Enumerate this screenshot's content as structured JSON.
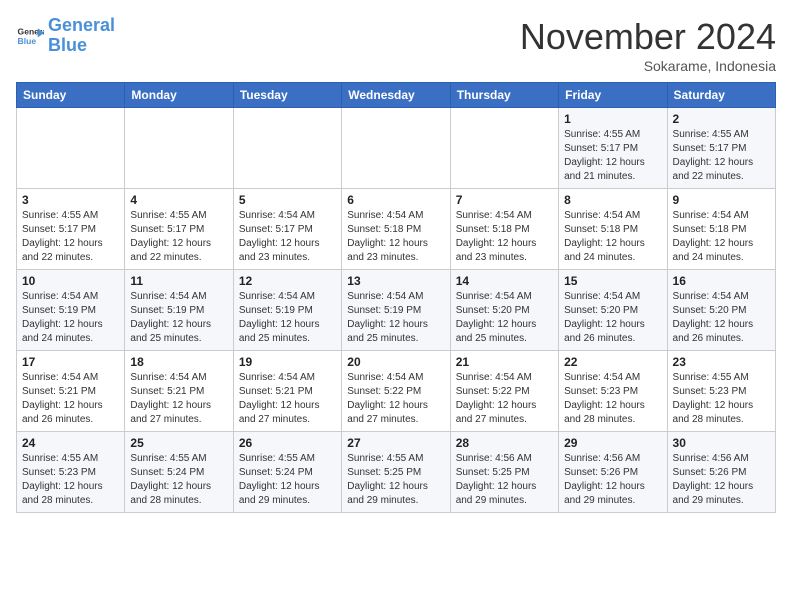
{
  "logo": {
    "line1": "General",
    "line2": "Blue"
  },
  "title": "November 2024",
  "subtitle": "Sokarame, Indonesia",
  "weekdays": [
    "Sunday",
    "Monday",
    "Tuesday",
    "Wednesday",
    "Thursday",
    "Friday",
    "Saturday"
  ],
  "weeks": [
    [
      {
        "day": "",
        "info": ""
      },
      {
        "day": "",
        "info": ""
      },
      {
        "day": "",
        "info": ""
      },
      {
        "day": "",
        "info": ""
      },
      {
        "day": "",
        "info": ""
      },
      {
        "day": "1",
        "info": "Sunrise: 4:55 AM\nSunset: 5:17 PM\nDaylight: 12 hours\nand 21 minutes."
      },
      {
        "day": "2",
        "info": "Sunrise: 4:55 AM\nSunset: 5:17 PM\nDaylight: 12 hours\nand 22 minutes."
      }
    ],
    [
      {
        "day": "3",
        "info": "Sunrise: 4:55 AM\nSunset: 5:17 PM\nDaylight: 12 hours\nand 22 minutes."
      },
      {
        "day": "4",
        "info": "Sunrise: 4:55 AM\nSunset: 5:17 PM\nDaylight: 12 hours\nand 22 minutes."
      },
      {
        "day": "5",
        "info": "Sunrise: 4:54 AM\nSunset: 5:17 PM\nDaylight: 12 hours\nand 23 minutes."
      },
      {
        "day": "6",
        "info": "Sunrise: 4:54 AM\nSunset: 5:18 PM\nDaylight: 12 hours\nand 23 minutes."
      },
      {
        "day": "7",
        "info": "Sunrise: 4:54 AM\nSunset: 5:18 PM\nDaylight: 12 hours\nand 23 minutes."
      },
      {
        "day": "8",
        "info": "Sunrise: 4:54 AM\nSunset: 5:18 PM\nDaylight: 12 hours\nand 24 minutes."
      },
      {
        "day": "9",
        "info": "Sunrise: 4:54 AM\nSunset: 5:18 PM\nDaylight: 12 hours\nand 24 minutes."
      }
    ],
    [
      {
        "day": "10",
        "info": "Sunrise: 4:54 AM\nSunset: 5:19 PM\nDaylight: 12 hours\nand 24 minutes."
      },
      {
        "day": "11",
        "info": "Sunrise: 4:54 AM\nSunset: 5:19 PM\nDaylight: 12 hours\nand 25 minutes."
      },
      {
        "day": "12",
        "info": "Sunrise: 4:54 AM\nSunset: 5:19 PM\nDaylight: 12 hours\nand 25 minutes."
      },
      {
        "day": "13",
        "info": "Sunrise: 4:54 AM\nSunset: 5:19 PM\nDaylight: 12 hours\nand 25 minutes."
      },
      {
        "day": "14",
        "info": "Sunrise: 4:54 AM\nSunset: 5:20 PM\nDaylight: 12 hours\nand 25 minutes."
      },
      {
        "day": "15",
        "info": "Sunrise: 4:54 AM\nSunset: 5:20 PM\nDaylight: 12 hours\nand 26 minutes."
      },
      {
        "day": "16",
        "info": "Sunrise: 4:54 AM\nSunset: 5:20 PM\nDaylight: 12 hours\nand 26 minutes."
      }
    ],
    [
      {
        "day": "17",
        "info": "Sunrise: 4:54 AM\nSunset: 5:21 PM\nDaylight: 12 hours\nand 26 minutes."
      },
      {
        "day": "18",
        "info": "Sunrise: 4:54 AM\nSunset: 5:21 PM\nDaylight: 12 hours\nand 27 minutes."
      },
      {
        "day": "19",
        "info": "Sunrise: 4:54 AM\nSunset: 5:21 PM\nDaylight: 12 hours\nand 27 minutes."
      },
      {
        "day": "20",
        "info": "Sunrise: 4:54 AM\nSunset: 5:22 PM\nDaylight: 12 hours\nand 27 minutes."
      },
      {
        "day": "21",
        "info": "Sunrise: 4:54 AM\nSunset: 5:22 PM\nDaylight: 12 hours\nand 27 minutes."
      },
      {
        "day": "22",
        "info": "Sunrise: 4:54 AM\nSunset: 5:23 PM\nDaylight: 12 hours\nand 28 minutes."
      },
      {
        "day": "23",
        "info": "Sunrise: 4:55 AM\nSunset: 5:23 PM\nDaylight: 12 hours\nand 28 minutes."
      }
    ],
    [
      {
        "day": "24",
        "info": "Sunrise: 4:55 AM\nSunset: 5:23 PM\nDaylight: 12 hours\nand 28 minutes."
      },
      {
        "day": "25",
        "info": "Sunrise: 4:55 AM\nSunset: 5:24 PM\nDaylight: 12 hours\nand 28 minutes."
      },
      {
        "day": "26",
        "info": "Sunrise: 4:55 AM\nSunset: 5:24 PM\nDaylight: 12 hours\nand 29 minutes."
      },
      {
        "day": "27",
        "info": "Sunrise: 4:55 AM\nSunset: 5:25 PM\nDaylight: 12 hours\nand 29 minutes."
      },
      {
        "day": "28",
        "info": "Sunrise: 4:56 AM\nSunset: 5:25 PM\nDaylight: 12 hours\nand 29 minutes."
      },
      {
        "day": "29",
        "info": "Sunrise: 4:56 AM\nSunset: 5:26 PM\nDaylight: 12 hours\nand 29 minutes."
      },
      {
        "day": "30",
        "info": "Sunrise: 4:56 AM\nSunset: 5:26 PM\nDaylight: 12 hours\nand 29 minutes."
      }
    ]
  ]
}
